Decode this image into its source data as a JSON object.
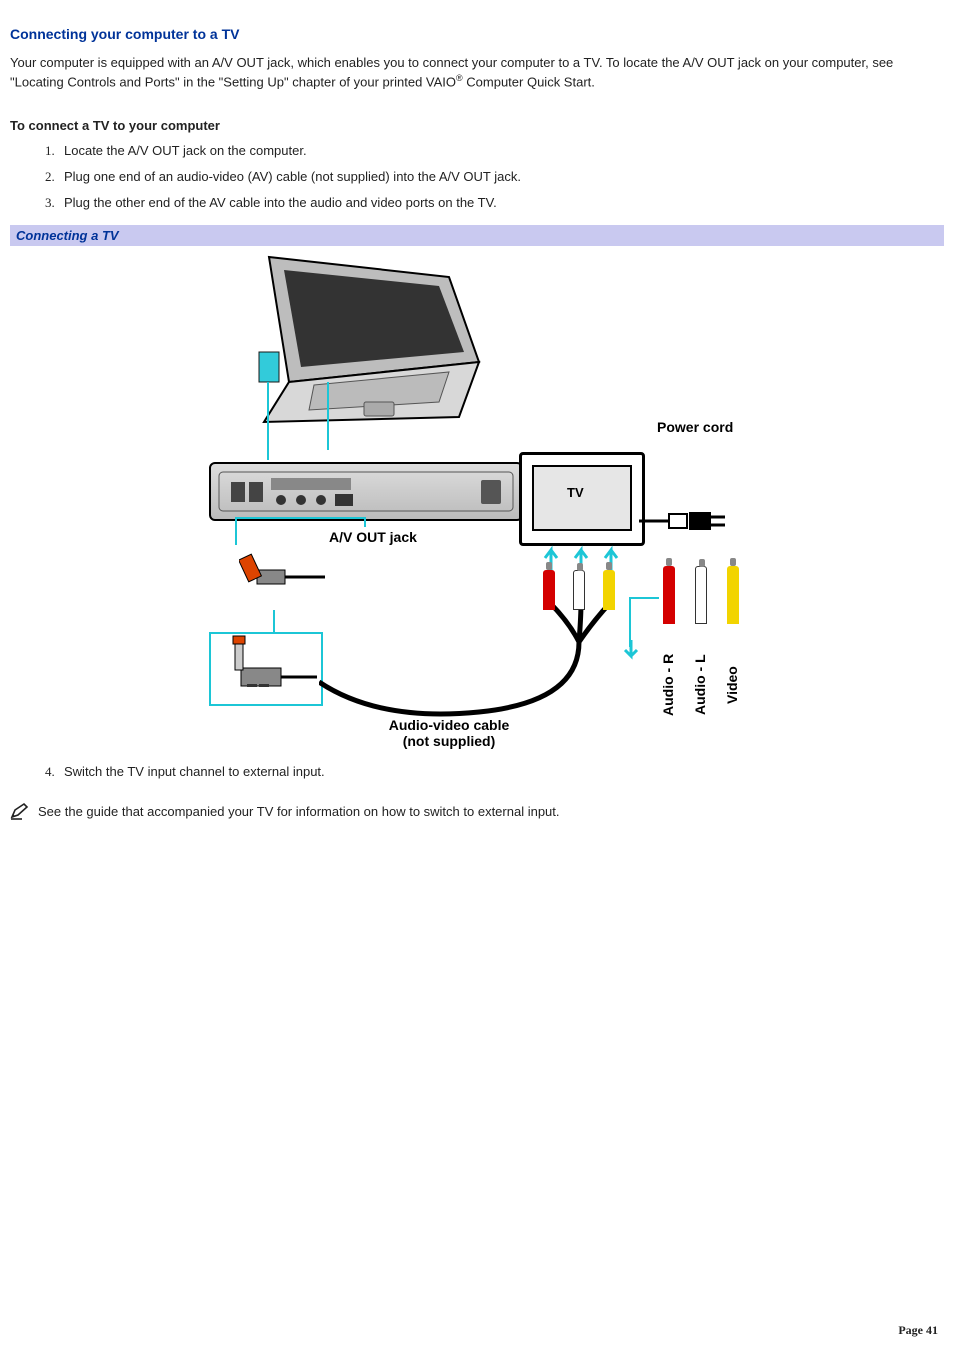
{
  "heading": "Connecting your computer to a TV",
  "intro_part1": "Your computer is equipped with an A/V OUT jack, which enables you to connect your computer to a TV. To locate the A/V OUT jack on your computer, see \"Locating Controls and Ports\" in the \"Setting Up\" chapter of your printed VAIO",
  "intro_sup": "®",
  "intro_part2": " Computer Quick Start.",
  "subhead": "To connect a TV to your computer",
  "steps_a": [
    "Locate the A/V OUT jack on the computer.",
    "Plug one end of an audio-video (AV) cable (not supplied) into the A/V OUT jack.",
    "Plug the other end of the AV cable into the audio and video ports on the TV."
  ],
  "figure_caption": "Connecting a TV",
  "fig_labels": {
    "power_cord": "Power cord",
    "tv": "TV",
    "av_out": "A/V OUT jack",
    "av_cable_l1": "Audio-video cable",
    "av_cable_l2": "(not supplied)",
    "audio_r": "Audio - R",
    "audio_l": "Audio - L",
    "video": "Video"
  },
  "steps_b": [
    "Switch the TV input channel to external input."
  ],
  "note_text": "See the guide that accompanied your TV for information on how to switch to external input.",
  "page_number": "Page 41"
}
